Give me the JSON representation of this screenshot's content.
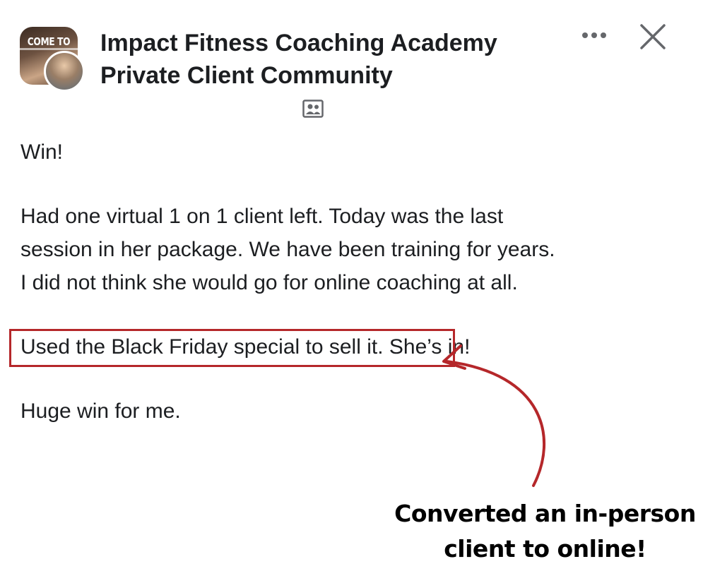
{
  "header": {
    "group_name_line1": "Impact Fitness Coaching Academy",
    "group_name_line2": "Private Client Community",
    "avatar_banner_text": "COME TO",
    "more_icon": "more-horizontal-icon",
    "close_icon": "close-icon",
    "audience_icon": "group-members-icon"
  },
  "post": {
    "paragraphs": [
      [
        "Win!"
      ],
      [
        "Had one virtual 1 on 1 client left. Today was the last",
        "session in her package. We have been training for years.",
        "I did not think she would go for online coaching at all."
      ],
      [
        "Used the Black Friday special to sell it. She’s in!"
      ],
      [
        "Huge win for me."
      ]
    ]
  },
  "annotation": {
    "caption_line1": "Converted an in-person",
    "caption_line2": "client to online!",
    "accent_color": "#b5272a"
  }
}
